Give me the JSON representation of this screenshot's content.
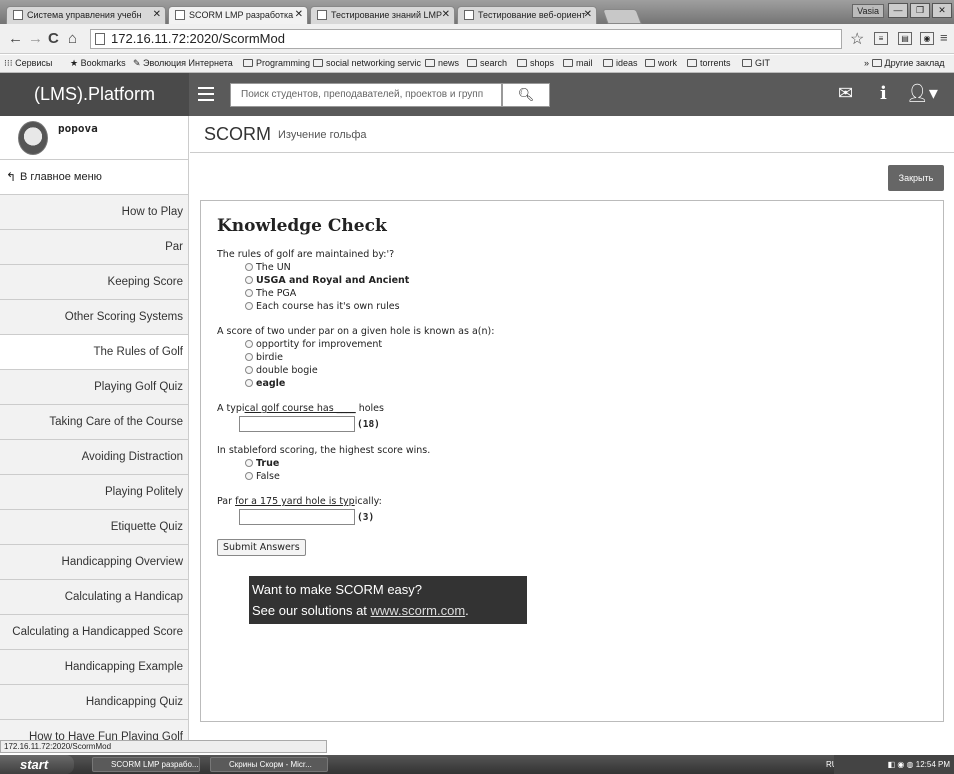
{
  "browser": {
    "tabs": [
      {
        "label": "Система управления учебн"
      },
      {
        "label": "SCORM LMP разработка"
      },
      {
        "label": "Тестирование знаний LMP"
      },
      {
        "label": "Тестирование веб-ориент"
      }
    ],
    "user_badge": "Vasia",
    "url": "172.16.11.72:2020/ScormMod",
    "bookmarks": [
      {
        "label": "Сервисы"
      },
      {
        "label": "Bookmarks"
      },
      {
        "label": "Эволюция Интернета"
      },
      {
        "label": "Programming"
      },
      {
        "label": "social networking servic"
      },
      {
        "label": "news"
      },
      {
        "label": "search"
      },
      {
        "label": "shops"
      },
      {
        "label": "mail"
      },
      {
        "label": "ideas"
      },
      {
        "label": "work"
      },
      {
        "label": "torrents"
      },
      {
        "label": "GIT"
      }
    ],
    "other_bookmarks": "Другие заклад"
  },
  "app": {
    "logo": "(LMS).Platform",
    "search_placeholder": "Поиск студентов, преподавателей, проектов и групп"
  },
  "sidebar": {
    "username": "popova",
    "back_label": "В главное меню",
    "items": [
      {
        "label": "How to Play"
      },
      {
        "label": "Par"
      },
      {
        "label": "Keeping Score"
      },
      {
        "label": "Other Scoring Systems"
      },
      {
        "label": "The Rules of Golf"
      },
      {
        "label": "Playing Golf Quiz"
      },
      {
        "label": "Taking Care of the Course"
      },
      {
        "label": "Avoiding Distraction"
      },
      {
        "label": "Playing Politely"
      },
      {
        "label": "Etiquette Quiz"
      },
      {
        "label": "Handicapping Overview"
      },
      {
        "label": "Calculating a Handicap"
      },
      {
        "label": "Calculating a Handicapped Score"
      },
      {
        "label": "Handicapping Example"
      },
      {
        "label": "Handicapping Quiz"
      },
      {
        "label": "How to Have Fun Playing Golf"
      }
    ]
  },
  "main": {
    "title": "SCORM",
    "subtitle": "Изучение гольфа",
    "close_label": "Закрыть"
  },
  "quiz": {
    "heading": "Knowledge Check",
    "q1": {
      "text": "The rules of golf are maintained by:'?",
      "options": [
        "The UN",
        "USGA and Royal and Ancient",
        "The PGA",
        "Each course has it's own rules"
      ]
    },
    "q2": {
      "text": "A score of two under par on a given hole is known as a(n):",
      "options": [
        "opportity for improvement",
        "birdie",
        "double bogie",
        "eagle"
      ]
    },
    "q3": {
      "text_prefix": "A typi",
      "text_underlined": "cal golf course has ____",
      "text_suffix": " holes",
      "answer": "(18)"
    },
    "q4": {
      "text": "In stableford scoring, the highest score wins.",
      "options": [
        "True",
        "False"
      ]
    },
    "q5": {
      "text_prefix": "Par ",
      "text_underlined": "for a 175 yard hole is typ",
      "text_suffix": "ically:",
      "answer": "(3)"
    },
    "submit_label": "Submit Answers",
    "ad": {
      "line1": "Want to make SCORM easy?",
      "line2_prefix": "See our solutions at ",
      "link": "www.scorm.com",
      "line2_suffix": "."
    }
  },
  "status_url": "172.16.11.72:2020/ScormMod",
  "taskbar": {
    "start": "start",
    "tasks": [
      {
        "label": "SCORM LMP разрабо..."
      },
      {
        "label": "Скрины Скорм - Micr..."
      }
    ],
    "lang": "RU",
    "clock": "12:54 PM"
  }
}
